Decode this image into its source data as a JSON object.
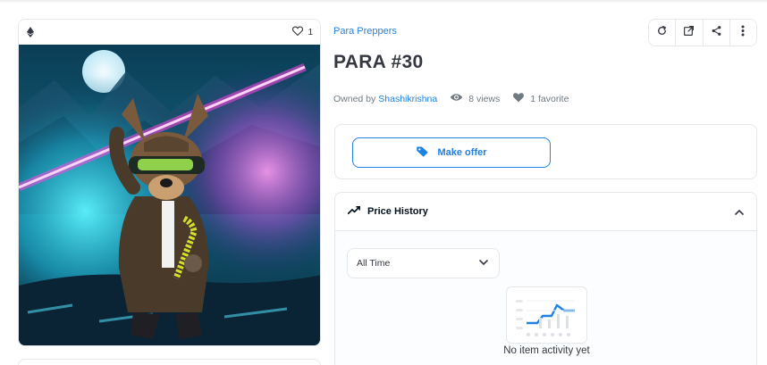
{
  "asset": {
    "favorite_count": "1",
    "collection": "Para Preppers",
    "title": "PARA #30",
    "owned_by_label": "Owned by",
    "owner": "Shashikrishna",
    "views": "8 views",
    "favorites": "1 favorite"
  },
  "actions": {
    "icons": [
      "refresh-icon",
      "external-link-icon",
      "share-icon",
      "more-icon"
    ]
  },
  "offer": {
    "button_label": "Make offer"
  },
  "price_history": {
    "title": "Price History",
    "filter_selected": "All Time",
    "empty_text": "No item activity yet"
  },
  "colors": {
    "accent": "#2081e2",
    "border": "#e5e8eb",
    "text_dark": "#353840",
    "text_muted": "#707a83"
  }
}
